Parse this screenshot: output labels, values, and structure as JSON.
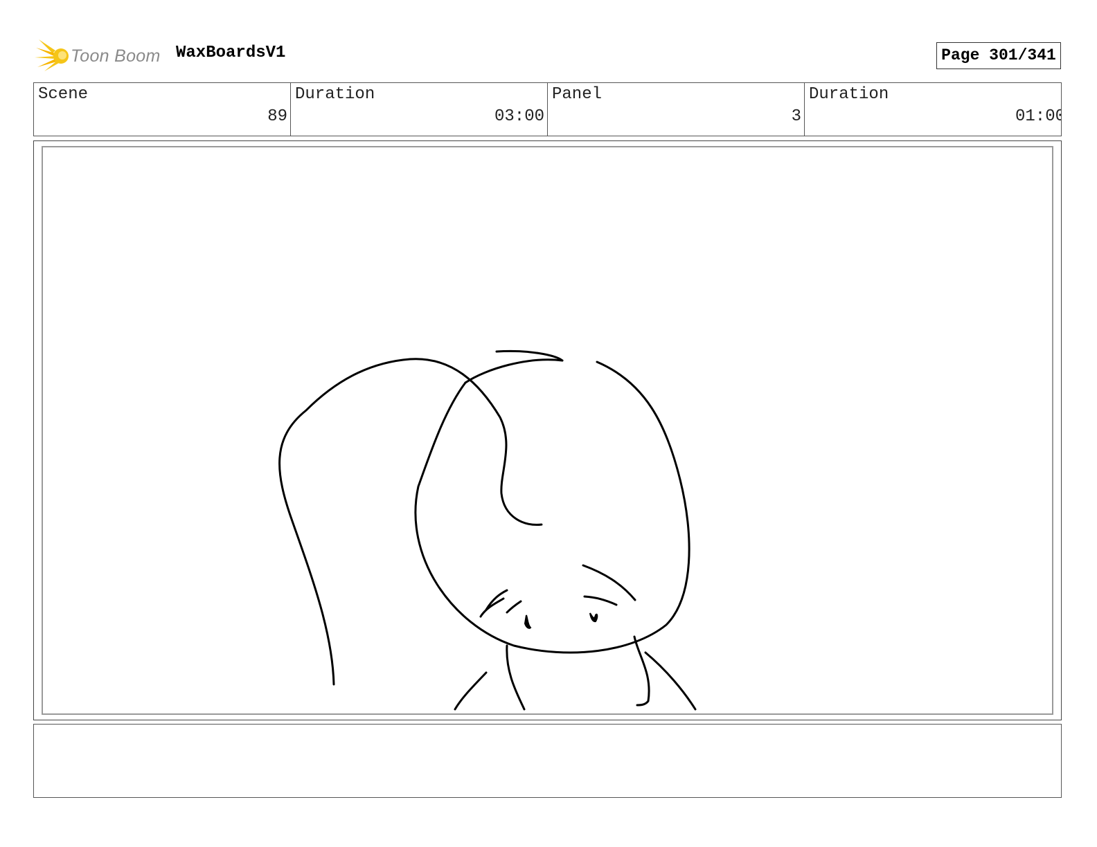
{
  "header": {
    "logo_text": "Toon Boom",
    "project_title": "WaxBoardsV1",
    "page_label": "Page 301/341"
  },
  "info": {
    "scene_label": "Scene",
    "scene_value": "89",
    "scene_duration_label": "Duration",
    "scene_duration_value": "03:00",
    "panel_label": "Panel",
    "panel_value": "3",
    "panel_duration_label": "Duration",
    "panel_duration_value": "01:00"
  },
  "notes": {
    "text": ""
  },
  "colors": {
    "logo_star": "#f5c518",
    "logo_text": "#8a8a8a",
    "panel_border": "#9a9a9a",
    "sketch_line": "#000000"
  },
  "icons": {
    "logo": "toon-boom-star-icon"
  }
}
